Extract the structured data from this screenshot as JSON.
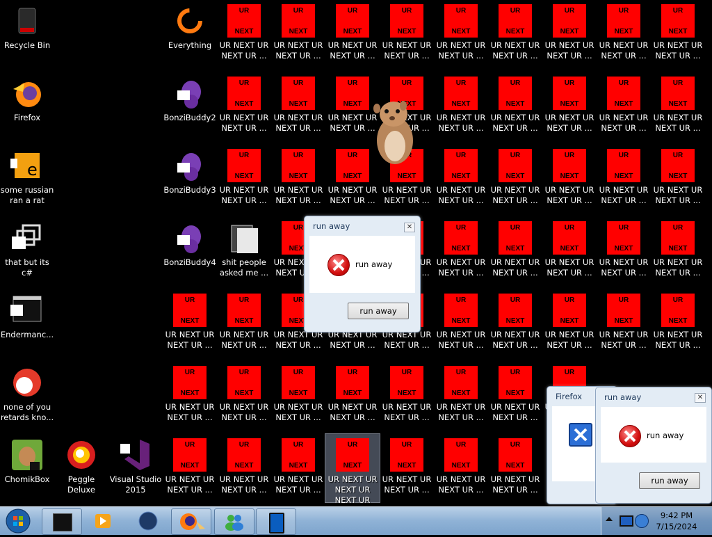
{
  "desktop": {
    "icons_left": [
      {
        "label": "Recycle Bin",
        "icon": "recycle-bin-icon"
      },
      {
        "label": "Firefox",
        "icon": "firefox-icon"
      },
      {
        "label": "some russian\nran a rat",
        "icon": "orange-app-icon"
      },
      {
        "label": "that but its c#",
        "icon": "window-stack-icon"
      },
      {
        "label": "Endermanc...",
        "icon": "terminal-icon"
      },
      {
        "label": "none of you\nretards kno...",
        "icon": "red-circle-icon"
      },
      {
        "label": "ChomikBox",
        "icon": "hamster-box-icon"
      }
    ],
    "icons_col2": [
      {
        "label": "Everything",
        "icon": "everything-search-icon"
      },
      {
        "label": "BonziBuddy2",
        "icon": "bonzi-icon"
      },
      {
        "label": "BonziBuddy3",
        "icon": "bonzi-icon"
      },
      {
        "label": "BonziBuddy4",
        "icon": "bonzi-icon"
      },
      {
        "label": "Peggle Deluxe",
        "icon": "peggle-icon"
      }
    ],
    "icons_col3": [
      {
        "label": "shit people\nasked me ...",
        "icon": "folder-icon"
      },
      {
        "label": "Visual Studio\n2015",
        "icon": "visual-studio-icon"
      }
    ],
    "tile": {
      "top": "UR",
      "bottom": "NEXT",
      "label": "UR NEXT UR\nNEXT UR ...",
      "selected_label": "UR NEXT UR\nNEXT UR\nNEXT UR"
    }
  },
  "dialogs": [
    {
      "title": "run away",
      "message": "run away",
      "button": "run away"
    },
    {
      "title": "Firefox"
    },
    {
      "title": "run away",
      "message": "run away",
      "button": "run away"
    }
  ],
  "taskbar": {
    "time": "9:42 PM",
    "date": "7/15/2024"
  }
}
